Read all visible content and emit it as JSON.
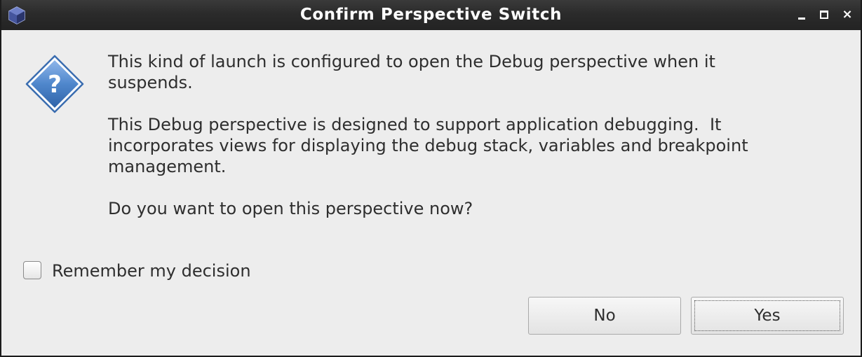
{
  "window": {
    "title": "Confirm Perspective Switch",
    "app_icon": "eclipse-cube-icon",
    "controls": {
      "minimize": "minimize-icon",
      "maximize": "maximize-icon",
      "close": "close-icon",
      "close_glyph": "×"
    }
  },
  "dialog": {
    "icon": "question-icon",
    "icon_glyph": "?",
    "message": [
      "This kind of launch is configured to open the Debug perspective when it\nsuspends.",
      "This Debug perspective is designed to support application debugging.  It\nincorporates views for displaying the debug stack, variables and breakpoint\nmanagement.",
      "Do you want to open this perspective now?"
    ],
    "remember": {
      "label": "Remember my decision",
      "checked": false
    },
    "buttons": {
      "no": "No",
      "yes": "Yes",
      "default": "yes"
    }
  },
  "colors": {
    "titlebar": "#2b2b2b",
    "dialog_bg": "#ededed",
    "icon_blue": "#4f87cc",
    "text": "#2e2e2e"
  }
}
